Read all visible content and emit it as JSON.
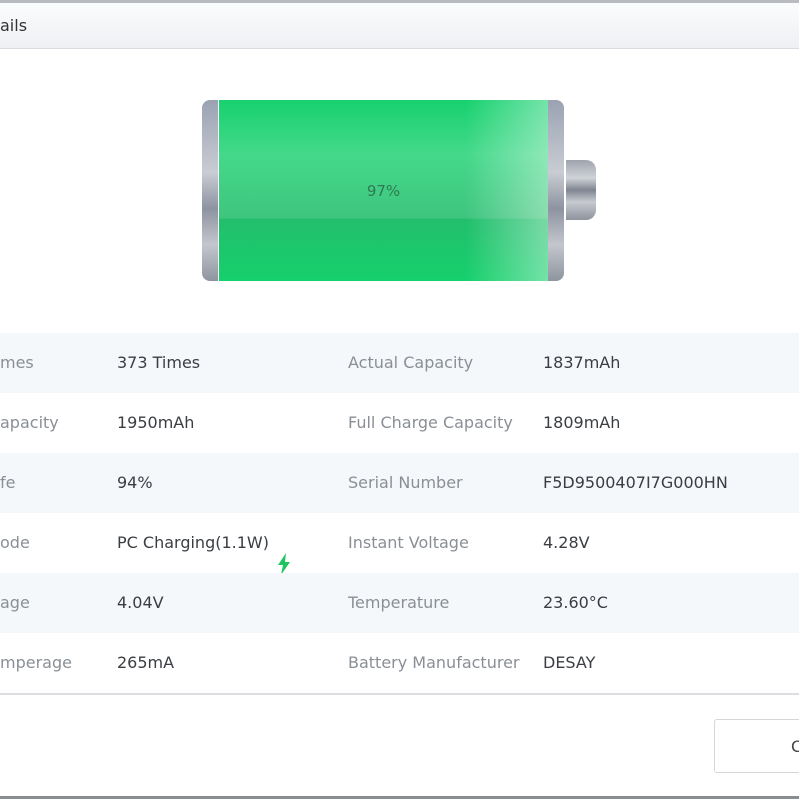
{
  "dialog": {
    "title": "ails"
  },
  "battery": {
    "level_percent": 97,
    "label": "97%",
    "fill_color": "#17d16f"
  },
  "rows": [
    {
      "l1": "mes",
      "v1": "373 Times",
      "l2": "Actual Capacity",
      "v2": "1837mAh"
    },
    {
      "l1": "apacity",
      "v1": "1950mAh",
      "l2": "Full Charge Capacity",
      "v2": "1809mAh"
    },
    {
      "l1": "fe",
      "v1": "94%",
      "l2": "Serial Number",
      "v2": "F5D9500407I7G000HN"
    },
    {
      "l1": "ode",
      "v1": "PC Charging(1.1W)",
      "l2": "Instant Voltage",
      "v2": "4.28V"
    },
    {
      "l1": "age",
      "v1": "4.04V",
      "l2": "Temperature",
      "v2": "23.60°C"
    },
    {
      "l1": "mperage",
      "v1": "265mA",
      "l2": "Battery Manufacturer",
      "v2": "DESAY"
    }
  ],
  "charging_icon": {
    "name": "lightning-bolt-icon",
    "color": "#1fc45e"
  },
  "footer": {
    "button_label": "C"
  }
}
